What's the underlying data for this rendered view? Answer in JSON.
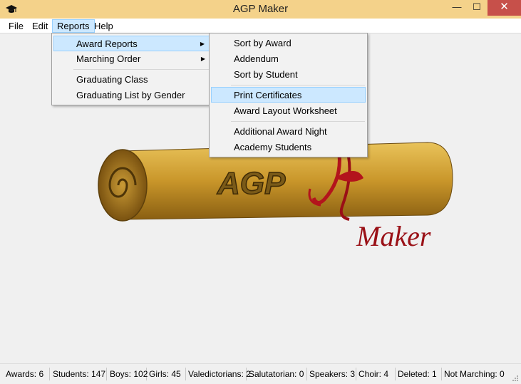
{
  "window": {
    "title": "AGP Maker",
    "minimize_glyph": "—",
    "maximize_glyph": "☐",
    "close_glyph": "✕",
    "icon": "mortarboard-icon"
  },
  "menubar": {
    "items": [
      "File",
      "Edit",
      "Reports",
      "Help"
    ]
  },
  "reports_menu": {
    "items": [
      {
        "label": "Award Reports",
        "submenu": true,
        "highlighted": true
      },
      {
        "label": "Marching Order",
        "submenu": true
      },
      {
        "label": "Graduating Class"
      },
      {
        "label": "Graduating List by Gender"
      }
    ]
  },
  "award_reports_menu": {
    "items": [
      {
        "label": "Sort by Award"
      },
      {
        "label": "Addendum"
      },
      {
        "label": "Sort by Student"
      },
      {
        "label": "Print Certificates",
        "highlighted": true
      },
      {
        "label": "Award Layout Worksheet"
      },
      {
        "label": "Additional Award Night"
      },
      {
        "label": "Academy Students"
      }
    ]
  },
  "logo": {
    "scroll_text": "AGP",
    "script_text": "Maker"
  },
  "statusbar": {
    "awards": "Awards: 6",
    "students": "Students: 147",
    "boys": "Boys: 102",
    "girls": "Girls: 45",
    "valedictorians": "Valedictorians: 2",
    "salutatorian": "Salutatorian: 0",
    "speakers": "Speakers: 3",
    "choir": "Choir: 4",
    "deleted": "Deleted: 1",
    "not_marching": "Not Marching: 0"
  },
  "colors": {
    "titlebar": "#f4d28a",
    "close_button": "#c7504a",
    "highlight": "#cce8ff",
    "highlight_border": "#99d1ff",
    "scroll_gold": "#c9962a",
    "ribbon_red": "#b3141c"
  }
}
